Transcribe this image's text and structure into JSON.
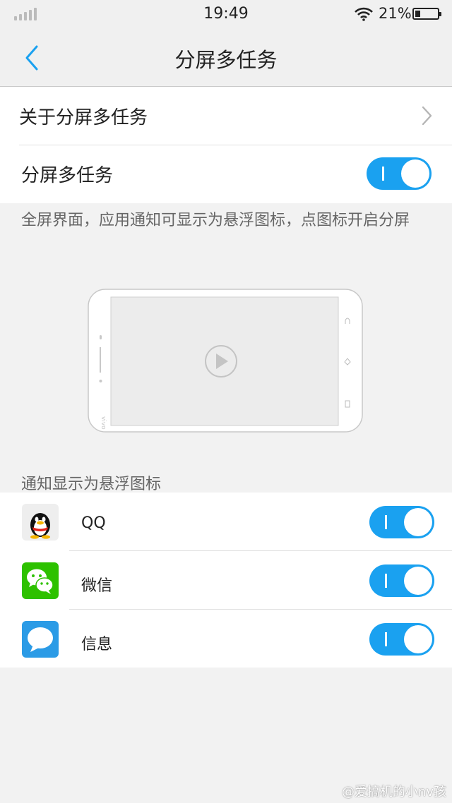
{
  "status_bar": {
    "time": "19:49",
    "battery_percent": "21%",
    "battery_level": 0.21,
    "signal_bars": 0,
    "wifi": "wifi-icon"
  },
  "header": {
    "title": "分屏多任务",
    "back_icon": "back-chevron-icon"
  },
  "settings": {
    "about_label": "关于分屏多任务",
    "toggle_label": "分屏多任务",
    "toggle_on": true,
    "description": "全屏界面，应用通知可显示为悬浮图标，点图标开启分屏"
  },
  "notifications": {
    "section_title": "通知显示为悬浮图标",
    "apps": [
      {
        "name": "QQ",
        "icon": "qq-penguin-icon",
        "enabled": true
      },
      {
        "name": "微信",
        "icon": "wechat-icon",
        "enabled": true
      },
      {
        "name": "信息",
        "icon": "messages-icon",
        "enabled": true
      }
    ]
  },
  "colors": {
    "accent": "#1aa1f0",
    "wechat_green": "#2dc100",
    "messages_blue": "#2b9be6"
  },
  "watermark": "@爱搞机的小nv孩"
}
